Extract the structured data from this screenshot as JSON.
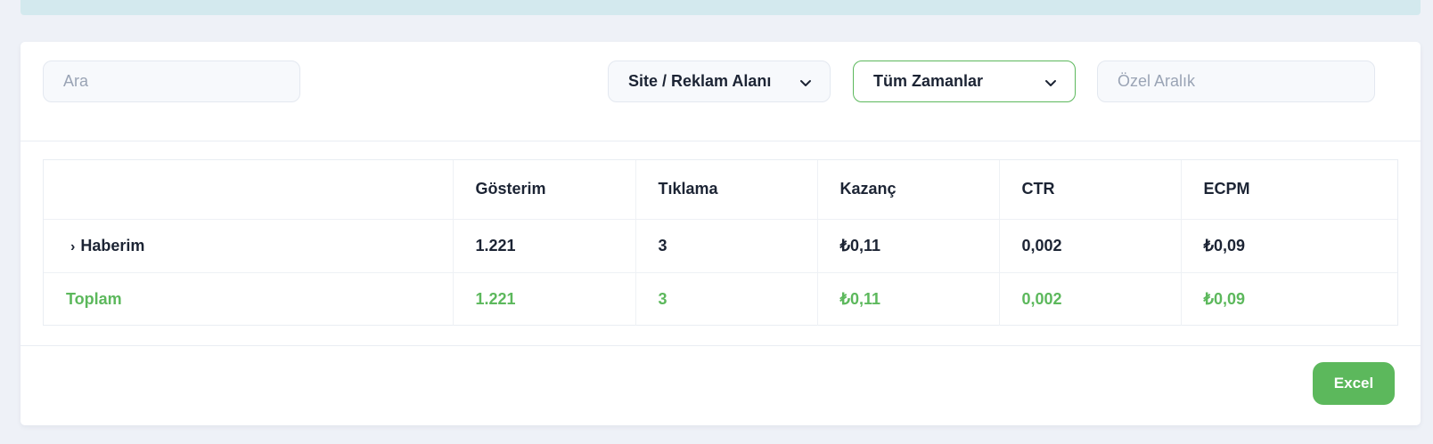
{
  "filters": {
    "search_placeholder": "Ara",
    "site_select": "Site / Reklam Alanı",
    "time_select": "Tüm Zamanlar",
    "custom_range_placeholder": "Özel Aralık"
  },
  "table": {
    "columns": [
      "",
      "Gösterim",
      "Tıklama",
      "Kazanç",
      "CTR",
      "ECPM"
    ],
    "rows": [
      {
        "caret": "›",
        "label": "Haberim",
        "values": [
          "1.221",
          "3",
          "₺0,11",
          "0,002",
          "₺0,09"
        ]
      }
    ],
    "total": {
      "label": "Toplam",
      "values": [
        "1.221",
        "3",
        "₺0,11",
        "0,002",
        "₺0,09"
      ]
    }
  },
  "actions": {
    "excel_label": "Excel"
  },
  "colors": {
    "accent": "#5cb85c",
    "text": "#1c2434",
    "banner": "#d3e9ee",
    "background": "#eef1f7"
  }
}
